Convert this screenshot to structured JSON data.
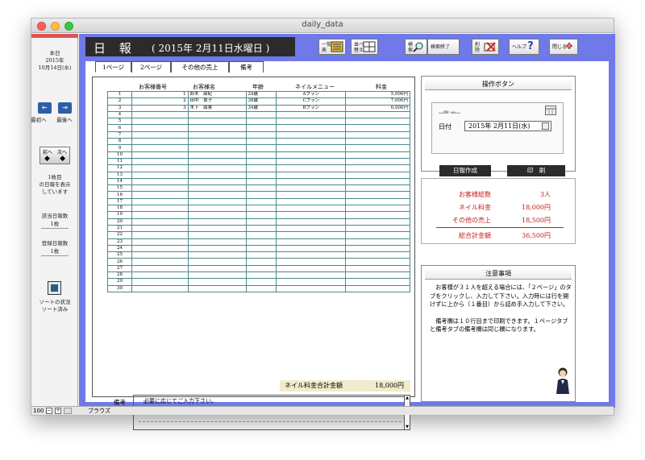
{
  "window": {
    "title": "daily_data"
  },
  "sidebar": {
    "today_label": "本日",
    "today_year": "2015年",
    "today_date": "10月14日(水)",
    "first_label": "最初へ",
    "last_label": "最後へ",
    "prev_label": "前へ",
    "next_label": "次へ",
    "display_info": [
      "1枚目",
      "の日報を表示",
      "しています"
    ],
    "matching_label": "該当日報数",
    "matching_count": "1枚",
    "registered_label": "登録日報数",
    "registered_count": "1枚",
    "sort_status_label": "ソートの状況",
    "sort_status_value": "ソート済み"
  },
  "statusbar": {
    "zoom": "100",
    "mode": "ブラウズ"
  },
  "header": {
    "title": "日 報",
    "date": "( 2015年 2月11日水曜日 )"
  },
  "toolbar": [
    {
      "label": "一覧\n表"
    },
    {
      "label": "並べ\n替え"
    },
    {
      "label": "検\n索"
    },
    {
      "label": "検索終了"
    },
    {
      "label": "削\n除"
    },
    {
      "label": "ヘルプ"
    },
    {
      "label": "閉じる"
    }
  ],
  "tabs": [
    "1ページ",
    "2ページ",
    "その他の売上",
    "備考"
  ],
  "table": {
    "headers": [
      "お客様番号",
      "お客様名",
      "年齢",
      "ネイルメニュー",
      "料金"
    ],
    "rows": [
      {
        "no": "1",
        "id": "1",
        "name": "鈴木　由紀",
        "age": "24歳",
        "menu": "Aプラン",
        "price": "5,000円"
      },
      {
        "no": "2",
        "id": "2",
        "name": "田中　景子",
        "age": "38歳",
        "menu": "Cプラン",
        "price": "7,000円"
      },
      {
        "no": "3",
        "id": "3",
        "name": "木下　由貴",
        "age": "34歳",
        "menu": "Bプラン",
        "price": "6,000円"
      },
      {
        "no": "4",
        "id": "",
        "name": "",
        "age": "",
        "menu": "",
        "price": ""
      },
      {
        "no": "5",
        "id": "",
        "name": "",
        "age": "",
        "menu": "",
        "price": ""
      },
      {
        "no": "6",
        "id": "",
        "name": "",
        "age": "",
        "menu": "",
        "price": ""
      },
      {
        "no": "7",
        "id": "",
        "name": "",
        "age": "",
        "menu": "",
        "price": ""
      },
      {
        "no": "8",
        "id": "",
        "name": "",
        "age": "",
        "menu": "",
        "price": ""
      },
      {
        "no": "9",
        "id": "",
        "name": "",
        "age": "",
        "menu": "",
        "price": ""
      },
      {
        "no": "10",
        "id": "",
        "name": "",
        "age": "",
        "menu": "",
        "price": ""
      },
      {
        "no": "11",
        "id": "",
        "name": "",
        "age": "",
        "menu": "",
        "price": ""
      },
      {
        "no": "12",
        "id": "",
        "name": "",
        "age": "",
        "menu": "",
        "price": ""
      },
      {
        "no": "13",
        "id": "",
        "name": "",
        "age": "",
        "menu": "",
        "price": ""
      },
      {
        "no": "14",
        "id": "",
        "name": "",
        "age": "",
        "menu": "",
        "price": ""
      },
      {
        "no": "15",
        "id": "",
        "name": "",
        "age": "",
        "menu": "",
        "price": ""
      },
      {
        "no": "16",
        "id": "",
        "name": "",
        "age": "",
        "menu": "",
        "price": ""
      },
      {
        "no": "17",
        "id": "",
        "name": "",
        "age": "",
        "menu": "",
        "price": ""
      },
      {
        "no": "18",
        "id": "",
        "name": "",
        "age": "",
        "menu": "",
        "price": ""
      },
      {
        "no": "19",
        "id": "",
        "name": "",
        "age": "",
        "menu": "",
        "price": ""
      },
      {
        "no": "20",
        "id": "",
        "name": "",
        "age": "",
        "menu": "",
        "price": ""
      },
      {
        "no": "21",
        "id": "",
        "name": "",
        "age": "",
        "menu": "",
        "price": ""
      },
      {
        "no": "22",
        "id": "",
        "name": "",
        "age": "",
        "menu": "",
        "price": ""
      },
      {
        "no": "23",
        "id": "",
        "name": "",
        "age": "",
        "menu": "",
        "price": ""
      },
      {
        "no": "24",
        "id": "",
        "name": "",
        "age": "",
        "menu": "",
        "price": ""
      },
      {
        "no": "25",
        "id": "",
        "name": "",
        "age": "",
        "menu": "",
        "price": ""
      },
      {
        "no": "26",
        "id": "",
        "name": "",
        "age": "",
        "menu": "",
        "price": ""
      },
      {
        "no": "27",
        "id": "",
        "name": "",
        "age": "",
        "menu": "",
        "price": ""
      },
      {
        "no": "28",
        "id": "",
        "name": "",
        "age": "",
        "menu": "",
        "price": ""
      },
      {
        "no": "29",
        "id": "",
        "name": "",
        "age": "",
        "menu": "",
        "price": ""
      },
      {
        "no": "30",
        "id": "",
        "name": "",
        "age": "",
        "menu": "",
        "price": ""
      }
    ],
    "total_label": "ネイル料金合計金額",
    "total_value": "18,000円"
  },
  "notes": {
    "label": "備考",
    "placeholder": "必要に応じてご入力下さい。"
  },
  "ops": {
    "title": "操作ボタン",
    "date_label": "日付",
    "date_value": "2015年 2月11日(水)",
    "create_button": "日報作成",
    "print_button": "印　刷"
  },
  "summary": {
    "customers_label": "お客様総数",
    "customers_value": "3人",
    "nail_label": "ネイル料金",
    "nail_value": "18,000円",
    "other_label": "その他の売上",
    "other_value": "18,500円",
    "total_label": "総合計金額",
    "total_value": "36,500円"
  },
  "caution": {
    "title": "注意事項",
    "para1": "　お客様が３１人を超える場合には、「２ページ」のタブをクリックし、入力して下さい。入力時には行を開けずに上から（１番目）から詰め手入力して下さい。",
    "para2": "　備考欄は１０行目まで印刷できます。１ページタブと備考タブの備考欄は同じ欄になります。"
  },
  "colors": {
    "background": "#6f79e8",
    "accent_red": "#c0201d",
    "header_dark": "#2b2b2b",
    "grid_line": "#4a8a8a"
  }
}
